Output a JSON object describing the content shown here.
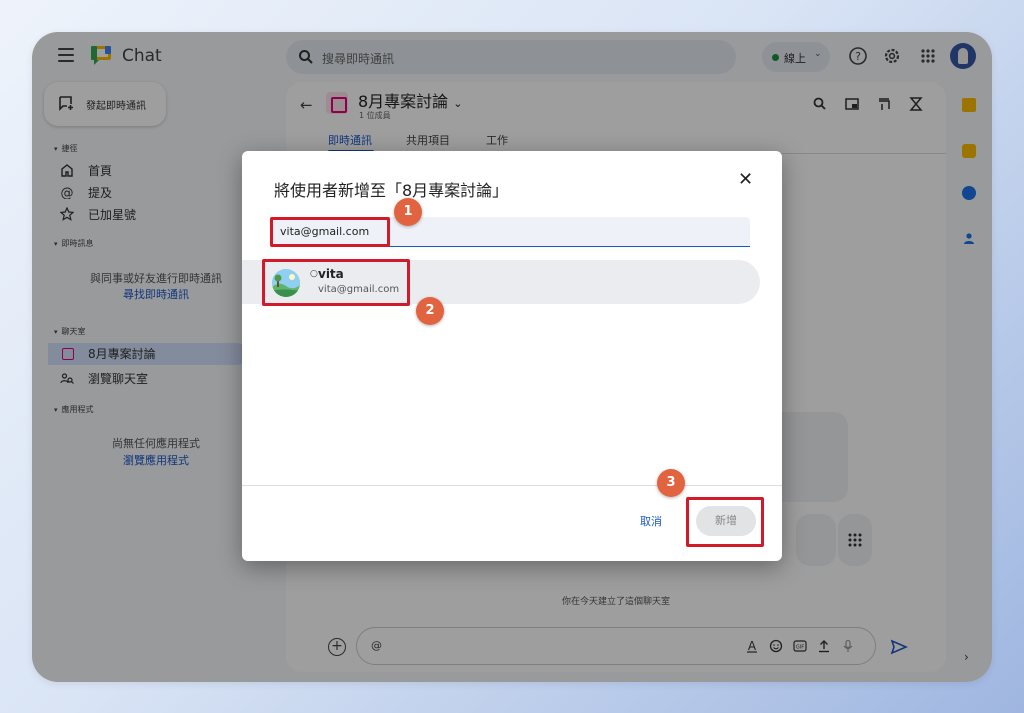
{
  "app": {
    "title": "Chat"
  },
  "search": {
    "placeholder": "搜尋即時通訊"
  },
  "status": {
    "label": "線上"
  },
  "sidebar": {
    "new_chat_label": "發起即時通訊",
    "shortcuts_header": "捷徑",
    "shortcuts": [
      {
        "label": "首頁",
        "icon": "home-icon"
      },
      {
        "label": "提及",
        "icon": "at-icon"
      },
      {
        "label": "已加星號",
        "icon": "star-icon"
      }
    ],
    "dm_header": "即時訊息",
    "dm_empty": "與同事或好友進行即時通訊",
    "dm_find_link": "尋找即時通訊",
    "rooms_header": "聊天室",
    "rooms": [
      {
        "label": "8月專案討論",
        "icon": "room-icon",
        "active": true
      },
      {
        "label": "瀏覽聊天室",
        "icon": "browse-rooms-icon"
      }
    ],
    "apps_header": "應用程式",
    "apps_empty": "尚無任何應用程式",
    "apps_browse_link": "瀏覽應用程式"
  },
  "main": {
    "room_name": "8月專案討論",
    "member_count": "1 位成員",
    "tabs": [
      "即時通訊",
      "共用項目",
      "工作"
    ],
    "created_note": "你在今天建立了這個聊天室",
    "composer_placeholder": "@"
  },
  "dialog": {
    "title": "將使用者新增至「8月專案討論」",
    "field_value": "vita@gmail.com",
    "suggestion": {
      "name": "vita",
      "email": "vita@gmail.com",
      "status_glyph": "○"
    },
    "cancel_label": "取消",
    "add_label": "新增"
  },
  "annotations": {
    "step1": "1",
    "step2": "2",
    "step3": "3"
  },
  "colors": {
    "accent": "#1a57c9",
    "highlight": "#d31a2a",
    "badge": "#e2633f"
  }
}
